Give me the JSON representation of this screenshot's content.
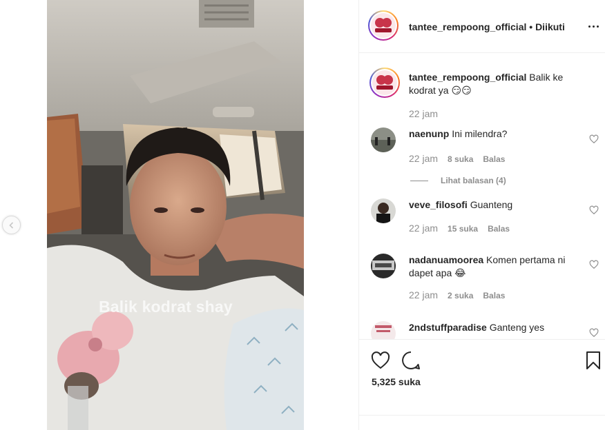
{
  "post": {
    "author": "tantee_rempoong_official",
    "follow_status": "Diikuti",
    "caption": "Balik ke kodrat ya 😏😏",
    "caption_time": "22 jam",
    "video_overlay_text": "Balik kodrat shay",
    "likes": "5,325 suka"
  },
  "comments": [
    {
      "user": "naenunp",
      "text": "Ini milendra?",
      "time": "22 jam",
      "likes": "8 suka",
      "reply": "Balas",
      "view_replies": "Lihat balasan (4)"
    },
    {
      "user": "veve_filosofi",
      "text": "Guanteng",
      "time": "22 jam",
      "likes": "15 suka",
      "reply": "Balas"
    },
    {
      "user": "nadanuamoorea",
      "text": "Komen pertama ni dapet apa 😂",
      "time": "22 jam",
      "likes": "2 suka",
      "reply": "Balas"
    },
    {
      "user": "2ndstuffparadise",
      "text": "Ganteng yes"
    }
  ],
  "icons": {
    "prev": "chevron-left-icon",
    "more": "more-horizontal-icon",
    "like": "heart-icon",
    "comment": "comment-icon",
    "save": "bookmark-icon"
  }
}
